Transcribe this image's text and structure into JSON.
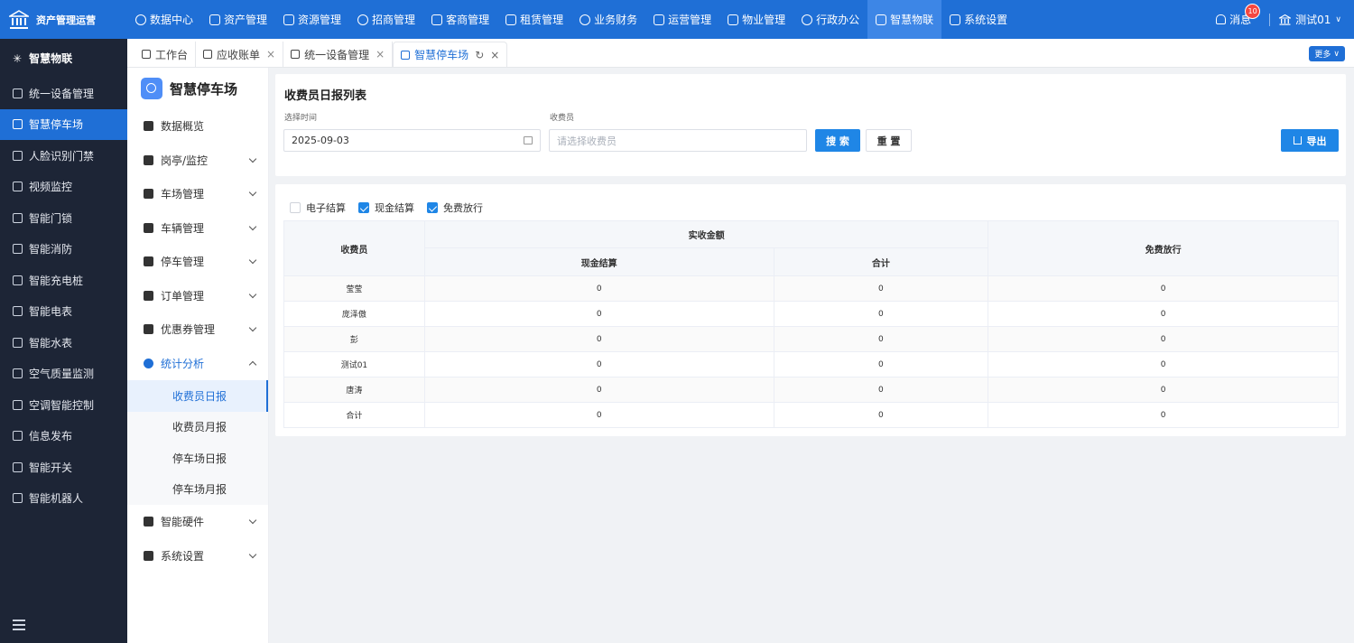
{
  "app": {
    "logo_text": "资产管理运营"
  },
  "topnav": [
    {
      "label": "数据中心",
      "active": false
    },
    {
      "label": "资产管理",
      "active": false
    },
    {
      "label": "资源管理",
      "active": false
    },
    {
      "label": "招商管理",
      "active": false
    },
    {
      "label": "客商管理",
      "active": false
    },
    {
      "label": "租赁管理",
      "active": false
    },
    {
      "label": "业务财务",
      "active": false
    },
    {
      "label": "运营管理",
      "active": false
    },
    {
      "label": "物业管理",
      "active": false
    },
    {
      "label": "行政办公",
      "active": false
    },
    {
      "label": "智慧物联",
      "active": true
    },
    {
      "label": "系统设置",
      "active": false
    }
  ],
  "header_right": {
    "message_label": "消息",
    "message_count": "10",
    "user_name": "测试01"
  },
  "sidebar": {
    "title": "智慧物联",
    "items": [
      {
        "label": "统一设备管理",
        "active": false
      },
      {
        "label": "智慧停车场",
        "active": true
      },
      {
        "label": "人脸识别门禁",
        "active": false
      },
      {
        "label": "视频监控",
        "active": false
      },
      {
        "label": "智能门锁",
        "active": false
      },
      {
        "label": "智能消防",
        "active": false
      },
      {
        "label": "智能充电桩",
        "active": false
      },
      {
        "label": "智能电表",
        "active": false
      },
      {
        "label": "智能水表",
        "active": false
      },
      {
        "label": "空气质量监测",
        "active": false
      },
      {
        "label": "空调智能控制",
        "active": false
      },
      {
        "label": "信息发布",
        "active": false
      },
      {
        "label": "智能开关",
        "active": false
      },
      {
        "label": "智能机器人",
        "active": false
      }
    ]
  },
  "tabs": [
    {
      "label": "工作台",
      "closable": false,
      "active": false
    },
    {
      "label": "应收账单",
      "closable": true,
      "active": false
    },
    {
      "label": "统一设备管理",
      "closable": true,
      "active": false
    },
    {
      "label": "智慧停车场",
      "closable": true,
      "active": true
    }
  ],
  "tabs_more_label": "更多",
  "submenu": {
    "title": "智慧停车场",
    "items_before": [
      {
        "label": "数据概览",
        "has_children": false
      },
      {
        "label": "岗亭/监控",
        "has_children": true
      },
      {
        "label": "车场管理",
        "has_children": true
      },
      {
        "label": "车辆管理",
        "has_children": true
      },
      {
        "label": "停车管理",
        "has_children": true
      },
      {
        "label": "订单管理",
        "has_children": true
      },
      {
        "label": "优惠券管理",
        "has_children": true
      }
    ],
    "open_group": {
      "label": "统计分析",
      "children": [
        {
          "label": "收费员日报",
          "active": true
        },
        {
          "label": "收费员月报",
          "active": false
        },
        {
          "label": "停车场日报",
          "active": false
        },
        {
          "label": "停车场月报",
          "active": false
        }
      ]
    },
    "items_after": [
      {
        "label": "智能硬件",
        "has_children": true
      },
      {
        "label": "系统设置",
        "has_children": true
      }
    ]
  },
  "filters": {
    "title": "收费员日报列表",
    "date_label": "选择时间",
    "date_value": "2025-09-03",
    "collector_label": "收费员",
    "collector_placeholder": "请选择收费员",
    "search_label": "搜 索",
    "reset_label": "重 置",
    "export_label": "导出"
  },
  "toggles": [
    {
      "label": "电子结算",
      "checked": false
    },
    {
      "label": "现金结算",
      "checked": true
    },
    {
      "label": "免费放行",
      "checked": true
    }
  ],
  "table": {
    "col_collector": "收费员",
    "group_actual": "实收金额",
    "col_cash": "现金结算",
    "col_total": "合计",
    "col_free": "免费放行",
    "rows": [
      {
        "name": "莹莹",
        "cash": "0",
        "total": "0",
        "free": "0"
      },
      {
        "name": "庞泽傲",
        "cash": "0",
        "total": "0",
        "free": "0"
      },
      {
        "name": "彭",
        "cash": "0",
        "total": "0",
        "free": "0"
      },
      {
        "name": "测试01",
        "cash": "0",
        "total": "0",
        "free": "0"
      },
      {
        "name": "唐涛",
        "cash": "0",
        "total": "0",
        "free": "0"
      },
      {
        "name": "合计",
        "cash": "0",
        "total": "0",
        "free": "0"
      }
    ]
  },
  "colors": {
    "primary": "#1f6fd6",
    "sidebar_bg": "#1d2536",
    "button_blue": "#1f86e6",
    "badge_red": "#f5463f"
  }
}
